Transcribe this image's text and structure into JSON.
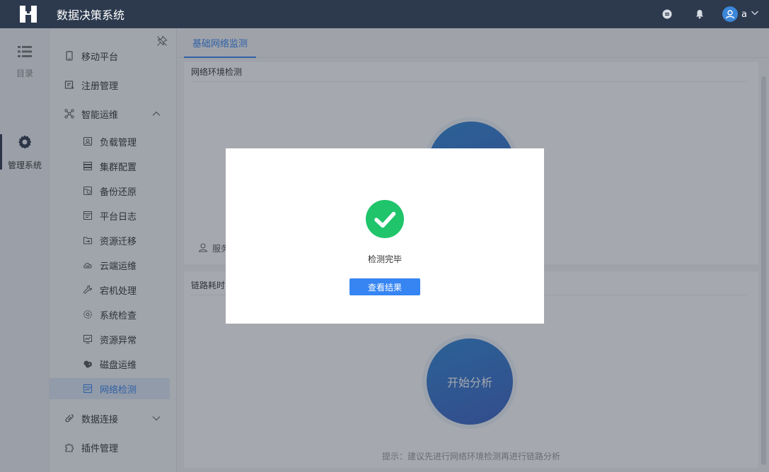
{
  "header": {
    "app_title": "数据决策系统",
    "user_name": "a",
    "icons": [
      "logo-icon",
      "message-icon",
      "bell-icon",
      "user-avatar-icon",
      "chevron-down-icon"
    ]
  },
  "rail": {
    "items": [
      {
        "label": "目录",
        "icon": "list-icon"
      },
      {
        "label": "管理系统",
        "icon": "gear-icon"
      }
    ]
  },
  "subnav": {
    "items": [
      {
        "label": "移动平台",
        "icon": "mobile-icon"
      },
      {
        "label": "注册管理",
        "icon": "register-icon"
      },
      {
        "label": "智能运维",
        "icon": "network-nodes-icon"
      },
      {
        "label": "负载管理",
        "icon": "load-icon"
      },
      {
        "label": "集群配置",
        "icon": "cluster-icon"
      },
      {
        "label": "备份还原",
        "icon": "backup-icon"
      },
      {
        "label": "平台日志",
        "icon": "log-icon"
      },
      {
        "label": "资源迁移",
        "icon": "migrate-icon"
      },
      {
        "label": "云端运维",
        "icon": "cloud-icon"
      },
      {
        "label": "宕机处理",
        "icon": "wrench-icon"
      },
      {
        "label": "系统检查",
        "icon": "check-gear-icon"
      },
      {
        "label": "资源异常",
        "icon": "monitor-icon"
      },
      {
        "label": "磁盘运维",
        "icon": "disk-icon"
      },
      {
        "label": "网络检测",
        "icon": "network-monitor-icon"
      },
      {
        "label": "数据连接",
        "icon": "link-icon"
      },
      {
        "label": "插件管理",
        "icon": "puzzle-icon"
      }
    ]
  },
  "main": {
    "tab_label": "基础网络监测",
    "panel1_title": "网络环境检测",
    "panel1_service_label": "服务器",
    "panel2_title": "链路耗时",
    "analyze_button": "开始分析",
    "hint": "提示：建议先进行网络环境检测再进行链路分析"
  },
  "dialog": {
    "message": "检测完毕",
    "button": "查看结果",
    "icon": "success-check-icon"
  },
  "colors": {
    "header_bg": "#2d3a4e",
    "accent": "#3685f2",
    "success": "#1fc46b",
    "active_nav_bg": "#dfe9f7"
  }
}
